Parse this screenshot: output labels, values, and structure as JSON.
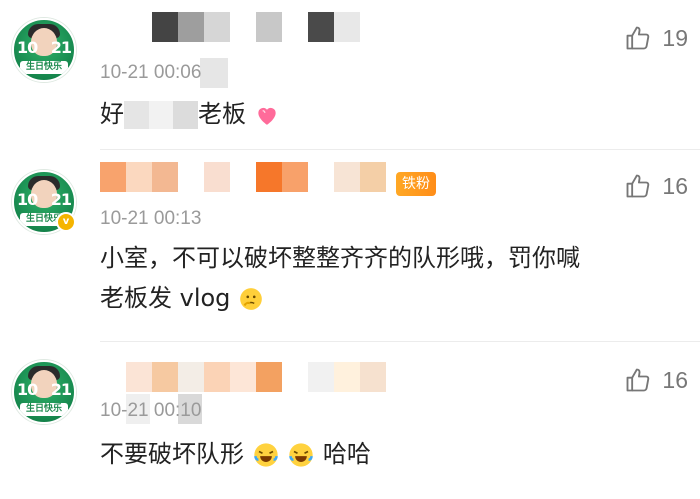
{
  "avatar_text": {
    "num_left": "10",
    "num_right": "21",
    "bday": "生日快乐"
  },
  "comments": [
    {
      "time": "10-21 00:06",
      "text_visible": "好",
      "text_tail": "老板",
      "likes": "19",
      "emoji": "pink-heart-emoji"
    },
    {
      "time": "10-21 00:13",
      "badge": "铁粉",
      "text_line1": "小室，不可以破坏整整齐齐的队形哦，罚你喊",
      "text_line2": "老板发 vlog",
      "likes": "16",
      "emoji": "thinking-face-emoji"
    },
    {
      "time": "10-21 00:10",
      "text_head": "不要破坏队形",
      "text_tail": "哈哈",
      "likes": "16",
      "emoji": "crying-laughing-emoji"
    }
  ]
}
